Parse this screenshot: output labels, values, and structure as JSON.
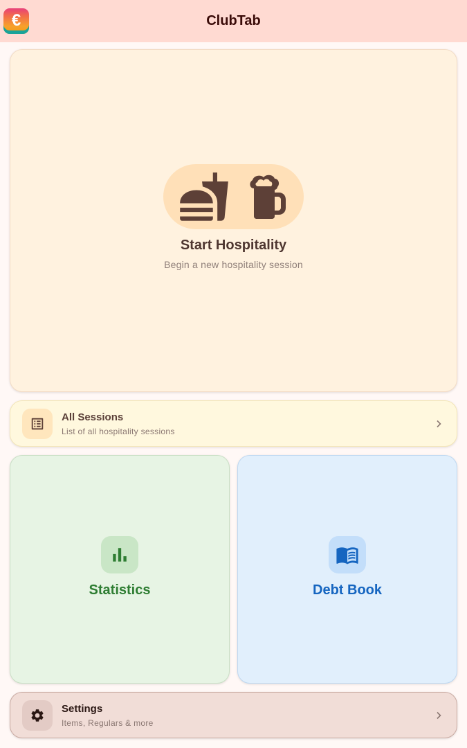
{
  "app": {
    "title": "ClubTab",
    "logo_glyph": "€",
    "logo_icon": "euro-logo-icon"
  },
  "hero": {
    "title": "Start Hospitality",
    "subtitle": "Begin a new hospitality session",
    "icons": [
      "fastfood-icon",
      "beer-mug-icon"
    ]
  },
  "sessions": {
    "title": "All Sessions",
    "subtitle": "List of all hospitality sessions",
    "icon": "list-alt-icon"
  },
  "statistics": {
    "label": "Statistics",
    "icon": "bar-chart-icon",
    "accent": "#2e7d32"
  },
  "debt_book": {
    "label": "Debt Book",
    "icon": "menu-book-icon",
    "accent": "#1565c0"
  },
  "settings": {
    "title": "Settings",
    "subtitle": "Items, Regulars & more",
    "icon": "gear-icon"
  },
  "colors": {
    "appbar": "#ffdad2",
    "hero_bg": "#fff2df",
    "hero_icon_color": "#5d4037"
  }
}
